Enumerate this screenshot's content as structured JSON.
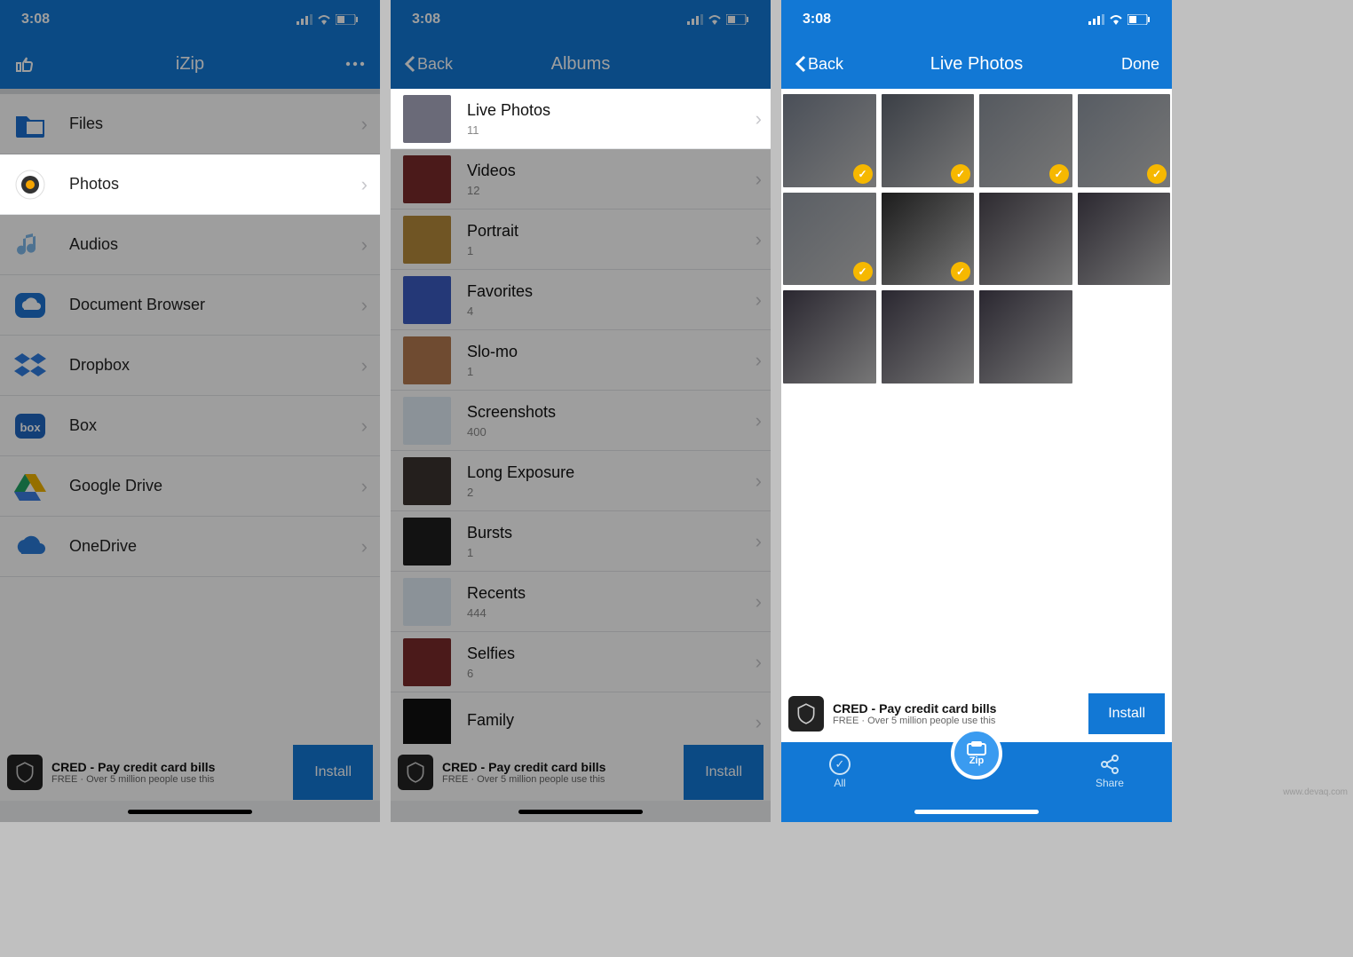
{
  "status": {
    "time": "3:08"
  },
  "screen1": {
    "title": "iZip",
    "rows": [
      {
        "label": "Files",
        "icon": "files-icon",
        "color": "#1a6fd0"
      },
      {
        "label": "Photos",
        "icon": "photos-icon",
        "color": "#f6a400",
        "highlight": true
      },
      {
        "label": "Audios",
        "icon": "audios-icon",
        "color": "#5fa6e6"
      },
      {
        "label": "Document Browser",
        "icon": "cloud-doc-icon",
        "color": "#1e73d2"
      },
      {
        "label": "Dropbox",
        "icon": "dropbox-icon",
        "color": "#2f7de0"
      },
      {
        "label": "Box",
        "icon": "box-icon",
        "color": "#2067c1"
      },
      {
        "label": "Google Drive",
        "icon": "gdrive-icon",
        "color": "#f0b400"
      },
      {
        "label": "OneDrive",
        "icon": "onedrive-icon",
        "color": "#2b7bd8"
      }
    ]
  },
  "screen2": {
    "back": "Back",
    "title": "Albums",
    "albums": [
      {
        "title": "Live Photos",
        "count": "11",
        "highlight": true,
        "thumb": "#6a6a78"
      },
      {
        "title": "Videos",
        "count": "12",
        "thumb": "#7a2b2b"
      },
      {
        "title": "Portrait",
        "count": "1",
        "thumb": "#b58a3a"
      },
      {
        "title": "Favorites",
        "count": "4",
        "thumb": "#3a5bc0"
      },
      {
        "title": "Slo-mo",
        "count": "1",
        "thumb": "#b47a50"
      },
      {
        "title": "Screenshots",
        "count": "400",
        "thumb": "#e0ecf6"
      },
      {
        "title": "Long Exposure",
        "count": "2",
        "thumb": "#3b3230"
      },
      {
        "title": "Bursts",
        "count": "1",
        "thumb": "#1e1e1e"
      },
      {
        "title": "Recents",
        "count": "444",
        "thumb": "#e0ecf6"
      },
      {
        "title": "Selfies",
        "count": "6",
        "thumb": "#7a2b2b"
      },
      {
        "title": "Family",
        "count": "",
        "thumb": "#111"
      }
    ]
  },
  "screen3": {
    "back": "Back",
    "title": "Live Photos",
    "done": "Done",
    "photos": [
      {
        "checked": true,
        "bg": "#4a4f58"
      },
      {
        "checked": true,
        "bg": "#3b3f46"
      },
      {
        "checked": true,
        "bg": "#55595f"
      },
      {
        "checked": true,
        "bg": "#575c63"
      },
      {
        "checked": true,
        "bg": "#5a5e64"
      },
      {
        "checked": true,
        "bg": "#1c1c1c"
      },
      {
        "checked": false,
        "bg": "#2d2a30"
      },
      {
        "checked": false,
        "bg": "#2b2830"
      },
      {
        "checked": false,
        "bg": "#2a2730"
      },
      {
        "checked": false,
        "bg": "#2a2730"
      },
      {
        "checked": false,
        "bg": "#2a2730"
      }
    ],
    "toolbar": {
      "all": "All",
      "zip": "Zip",
      "share": "Share"
    }
  },
  "ad": {
    "title": "CRED - Pay credit card bills",
    "subtitle": "FREE · Over 5 million people use this",
    "button": "Install"
  },
  "watermark": "www.devaq.com"
}
